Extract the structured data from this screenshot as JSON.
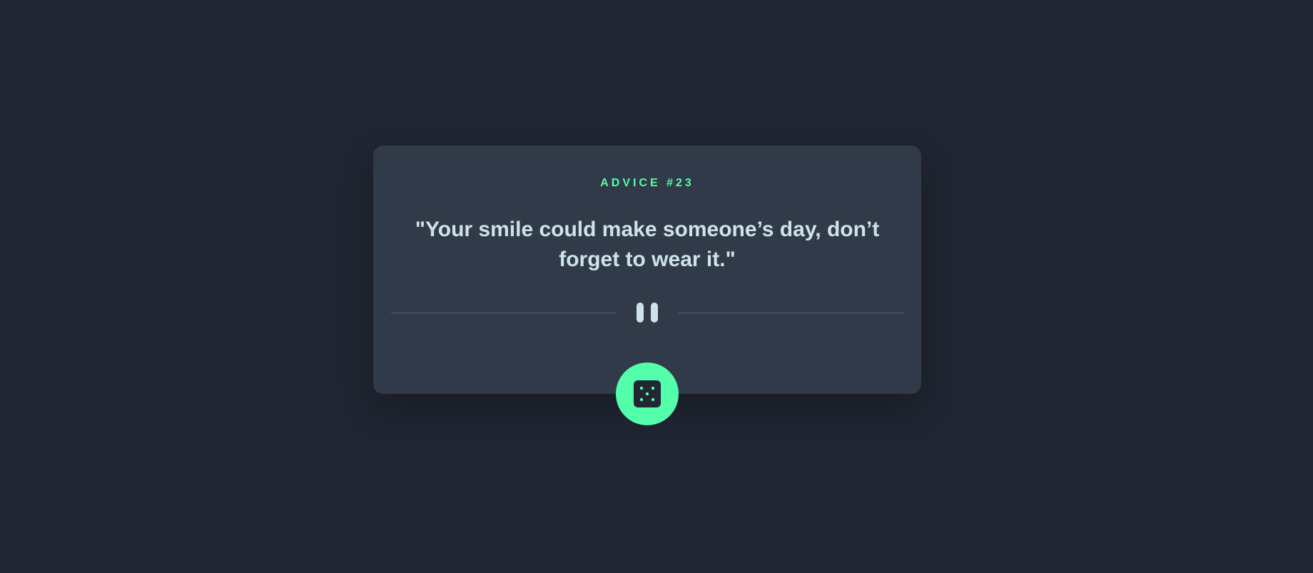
{
  "advice": {
    "id_label": "ADVICE #23",
    "text": "\"Your smile could make someone’s day, don’t forget to wear it.\""
  },
  "icons": {
    "divider": "pause-icon",
    "button": "dice-icon"
  },
  "colors": {
    "background": "#202632",
    "card": "#313a48",
    "accent": "#53ffaa",
    "text": "#cee3e9",
    "divider": "#4f5d74"
  }
}
